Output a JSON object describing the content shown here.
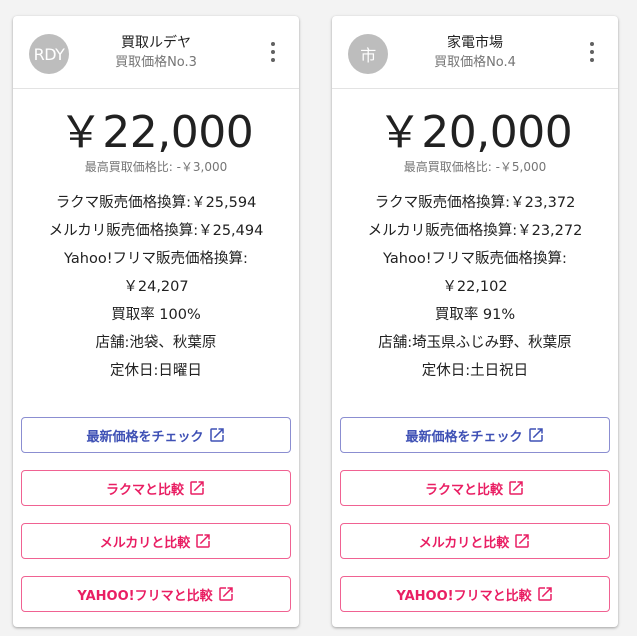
{
  "colors": {
    "primary": "#3f51b5",
    "pink": "#e91e63",
    "avatar_bg": "#bdbdbd"
  },
  "cards": [
    {
      "avatar_text": "RDY",
      "shop_name": "買取ルデヤ",
      "shop_sub": "買取価格No.3",
      "price": "￥22,000",
      "price_diff": "最高買取価格比: -￥3,000",
      "details": [
        "ラクマ販売価格換算:￥25,594",
        "メルカリ販売価格換算:￥25,494",
        "Yahoo!フリマ販売価格換算:",
        "￥24,207",
        "買取率 100%",
        "店舗:池袋、秋葉原",
        "定休日:日曜日"
      ],
      "buttons": [
        "最新価格をチェック",
        "ラクマと比較",
        "メルカリと比較",
        "YAHOO!フリマと比較"
      ]
    },
    {
      "avatar_text": "市",
      "shop_name": "家電市場",
      "shop_sub": "買取価格No.4",
      "price": "￥20,000",
      "price_diff": "最高買取価格比: -￥5,000",
      "details": [
        "ラクマ販売価格換算:￥23,372",
        "メルカリ販売価格換算:￥23,272",
        "Yahoo!フリマ販売価格換算:",
        "￥22,102",
        "買取率 91%",
        "店舗:埼玉県ふじみ野、秋葉原",
        "定休日:土日祝日"
      ],
      "buttons": [
        "最新価格をチェック",
        "ラクマと比較",
        "メルカリと比較",
        "YAHOO!フリマと比較"
      ]
    }
  ]
}
